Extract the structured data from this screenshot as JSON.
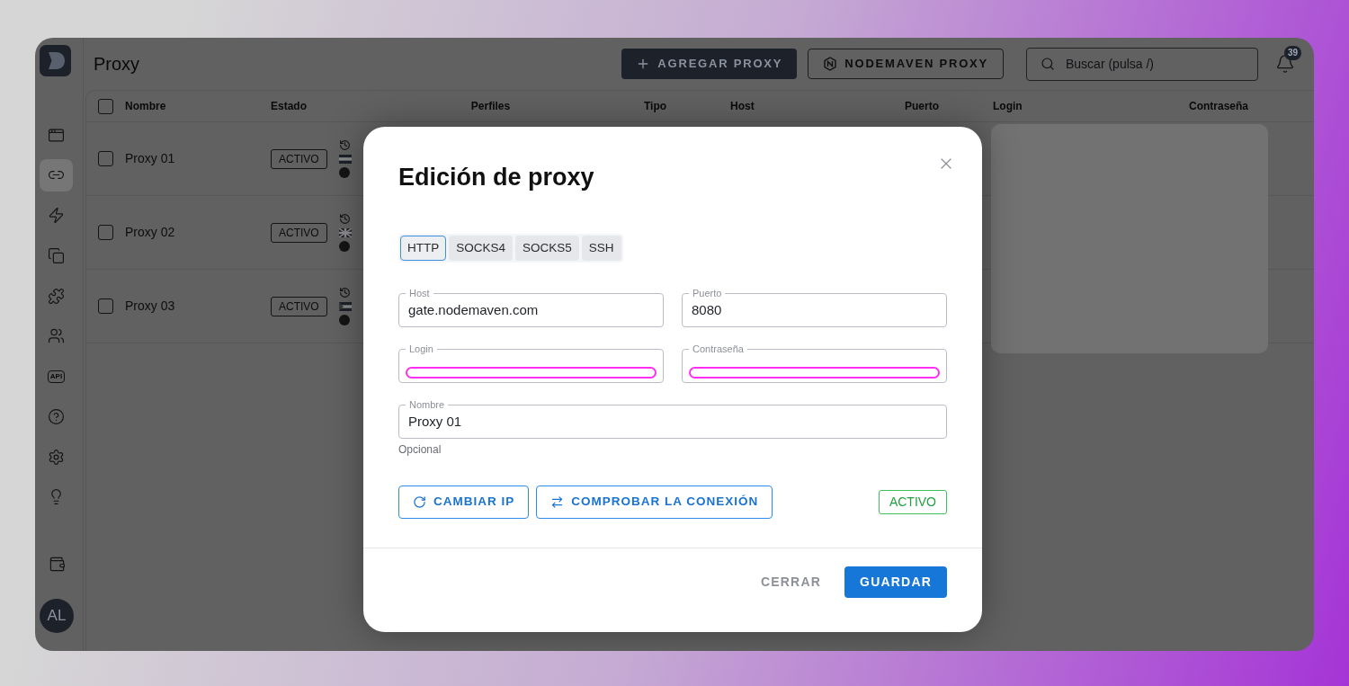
{
  "sidebar": {
    "items": [
      {
        "selected": false
      },
      {
        "selected": true
      },
      {
        "selected": false
      },
      {
        "selected": false
      },
      {
        "selected": false
      },
      {
        "selected": false
      },
      {
        "selected": false,
        "text": "API"
      },
      {
        "selected": false
      },
      {
        "selected": false
      },
      {
        "selected": false
      }
    ],
    "avatar": {
      "initials": "AL"
    }
  },
  "header": {
    "title": "Proxy",
    "buttons": [
      {
        "label": "AGREGAR PROXY",
        "kind": "filled"
      },
      {
        "label": "NODEMAVEN PROXY",
        "kind": "outlined"
      }
    ],
    "search": {
      "placeholder": "Buscar (pulsa /)"
    },
    "notifications": {
      "count": "39"
    }
  },
  "table": {
    "select_all_checked": false,
    "columns": [
      "Nombre",
      "Estado",
      "Perfiles",
      "Tipo",
      "Host",
      "Puerto",
      "Login",
      "Contraseña"
    ],
    "rows": [
      {
        "checked": false,
        "name": "Proxy 01",
        "status": "ACTIVO"
      },
      {
        "checked": false,
        "name": "Proxy 02",
        "status": "ACTIVO"
      },
      {
        "checked": false,
        "name": "Proxy 03",
        "status": "ACTIVO"
      }
    ]
  },
  "modal": {
    "title": "Edición de proxy",
    "protocol_tabs": [
      {
        "label": "HTTP",
        "selected": true
      },
      {
        "label": "SOCKS4",
        "selected": false
      },
      {
        "label": "SOCKS5",
        "selected": false
      },
      {
        "label": "SSH",
        "selected": false
      }
    ],
    "fields": [
      {
        "label": "Host",
        "value": "gate.nodemaven.com",
        "highlighted": false
      },
      {
        "label": "Puerto",
        "value": "8080",
        "highlighted": false
      },
      {
        "label": "Login",
        "highlighted": true
      },
      {
        "label": "Contraseña",
        "highlighted": true
      },
      {
        "label": "Nombre",
        "value": "Proxy 01",
        "highlighted": false,
        "helper": "Opcional"
      }
    ],
    "actions": [
      {
        "label": "CAMBIAR IP"
      },
      {
        "label": "COMPROBAR LA CONEXIÓN"
      }
    ],
    "status": "ACTIVO",
    "footer_buttons": [
      {
        "label": "CERRAR",
        "kind": "text"
      },
      {
        "label": "GUARDAR",
        "kind": "filled"
      }
    ]
  }
}
